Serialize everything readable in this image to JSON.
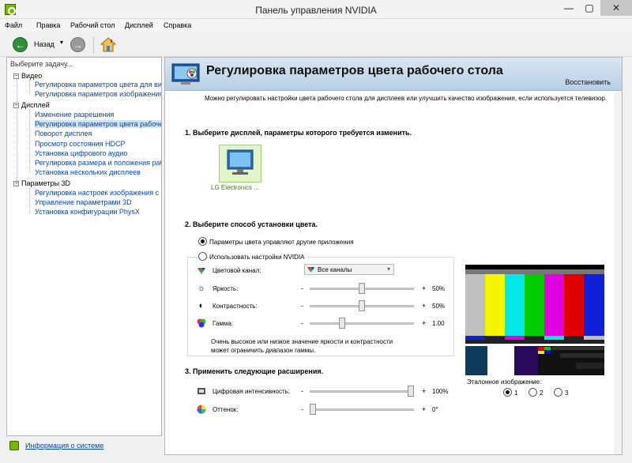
{
  "window": {
    "title": "Панель управления NVIDIA",
    "minimize": "—",
    "maximize": "▢",
    "close": "✕"
  },
  "menu": [
    "Файл",
    "Правка",
    "Рабочий стол",
    "Дисплей",
    "Справка"
  ],
  "toolbar": {
    "back_label": "Назад",
    "back_arrow": "←",
    "forward_arrow": "→",
    "dropdown": "▾"
  },
  "sidebar": {
    "header": "Выберите задачу...",
    "categories": [
      {
        "label": "Видео",
        "expander": "−",
        "items": [
          "Регулировка параметров цвета для видео",
          "Регулировка параметров изображения для видео"
        ]
      },
      {
        "label": "Дисплей",
        "expander": "−",
        "items": [
          "Изменение разрешения",
          "Регулировка параметров цвета рабочего стола",
          "Поворот дисплея",
          "Просмотр состояния HDCP",
          "Установка цифрового аудио",
          "Регулировка размера и положения рабочего стола",
          "Установка нескольких дисплеев"
        ]
      },
      {
        "label": "Параметры 3D",
        "expander": "−",
        "items": [
          "Регулировка настроек изображения с просмотром",
          "Управление параметрами 3D",
          "Установка конфигурации PhysX"
        ]
      }
    ],
    "selected": "Регулировка параметров цвета рабочего стола"
  },
  "status": {
    "link": "Информация о системе"
  },
  "content": {
    "title": "Регулировка параметров цвета рабочего стола",
    "restore": "Восстановить",
    "intro": "Можно регулировать настройки цвета рабочего стола для дисплеев или улучшить качество изображения, если используется телевизор.",
    "section1": "1. Выберите дисплей, параметры которого требуется изменить.",
    "display_name": "LG Electronics ...",
    "section2": "2. Выберите способ установки цвета.",
    "radio_other": "Параметры цвета управляют другие приложения",
    "radio_nvidia": "Использовать настройки NVIDIA",
    "channel_label": "Цветовой канал:",
    "channel_value": "Все каналы",
    "brightness": {
      "label": "Яркость:",
      "value": "50%",
      "level": 0.5
    },
    "contrast": {
      "label": "Контрастность:",
      "value": "50%",
      "level": 0.5
    },
    "gamma": {
      "label": "Гамма:",
      "value": "1.00",
      "level": 0.3
    },
    "minus": "-",
    "plus": "+",
    "warning": "Очень высокое или низкое значение яркости и контрастности может ограничить диапазон гаммы.",
    "section3": "3. Применить следующие расширения.",
    "vibrance": {
      "label": "Цифровая интенсивность:",
      "value": "100%",
      "level": 1.0
    },
    "hue": {
      "label": "Оттенок:",
      "value": "0°",
      "level": 0.0
    },
    "reference_label": "Эталонное изображение:",
    "reference_options": [
      "1",
      "2",
      "3"
    ],
    "reference_selected": "1"
  },
  "colors": {
    "nvidia_green": "#76b900",
    "link_blue": "#0a46a8"
  }
}
